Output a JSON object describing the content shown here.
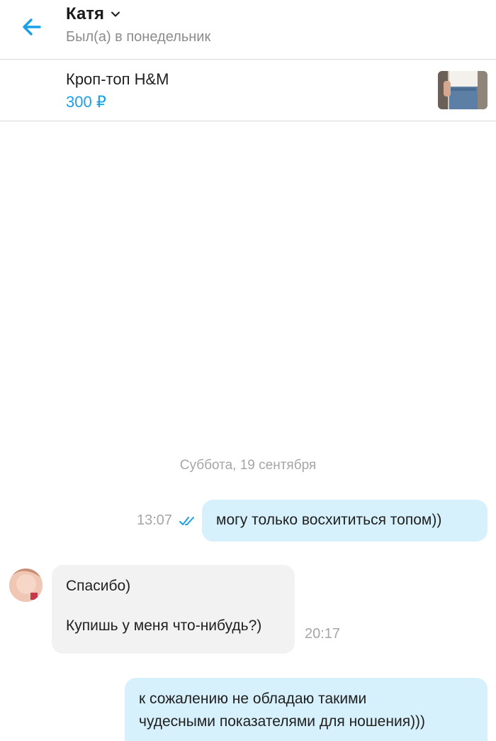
{
  "header": {
    "contact_name": "Катя",
    "status": "Был(а) в понедельник",
    "icons": {
      "back": "arrow-left-icon",
      "expand": "chevron-down-icon"
    },
    "accent_color": "#1aa0e6"
  },
  "product": {
    "title": "Кроп-топ H&M",
    "price": "300 ₽"
  },
  "chat": {
    "date_separator": "Суббота, 19 сентября",
    "messages": [
      {
        "direction": "out",
        "time": "13:07",
        "read_status": "double-check-icon",
        "lines": [
          "могу только восхититься топом))"
        ]
      },
      {
        "direction": "in",
        "time": "20:17",
        "lines": [
          "Спасибо)",
          "",
          "Купишь у меня что-нибудь?)"
        ]
      },
      {
        "direction": "out",
        "lines": [
          "к сожалению не обладаю такими",
          "чудесными показателями для ношения)))"
        ]
      }
    ]
  }
}
